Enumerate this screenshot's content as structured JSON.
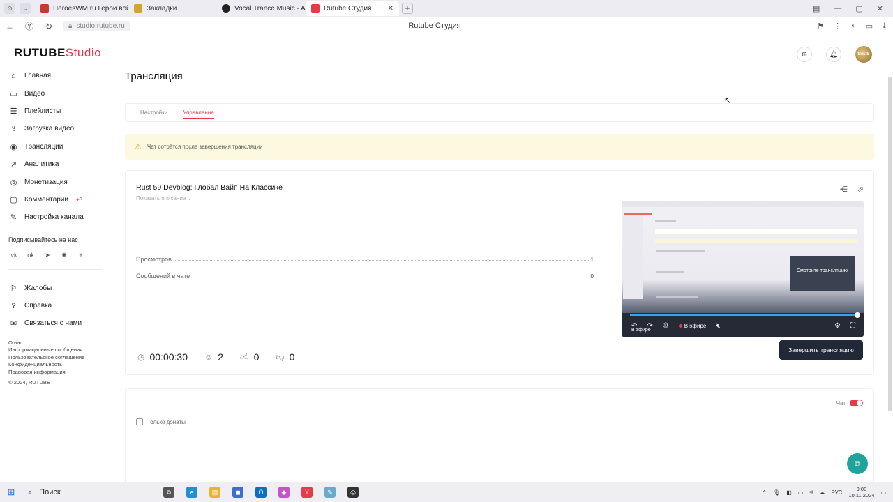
{
  "browser": {
    "tabs": [
      {
        "title": "HeroesWM.ru Герои войн",
        "color": "#c23b2f"
      },
      {
        "title": "Закладки",
        "color": "#d1a43a"
      },
      {
        "title": "Vocal Trance Music - Arise",
        "color": "#222"
      },
      {
        "title": "Rutube Студия",
        "color": "#e63a4a",
        "active": true
      }
    ],
    "new_tab": "+",
    "url": "studio.rutube.ru",
    "page_title": "Rutube Студия"
  },
  "app": {
    "logo_main": "RUTUBE",
    "logo_studio": "Studio",
    "avatar_text": "BestS"
  },
  "sidebar": {
    "items": [
      {
        "label": "Главная",
        "icon": "home-icon",
        "glyph": "⌂"
      },
      {
        "label": "Видео",
        "icon": "video-icon",
        "glyph": "▭"
      },
      {
        "label": "Плейлисты",
        "icon": "playlist-icon",
        "glyph": "☰"
      },
      {
        "label": "Загрузка видео",
        "icon": "upload-icon",
        "glyph": "⇪"
      },
      {
        "label": "Трансляции",
        "icon": "broadcast-icon",
        "glyph": "◉"
      },
      {
        "label": "Аналитика",
        "icon": "analytics-icon",
        "glyph": "↗"
      },
      {
        "label": "Монетизация",
        "icon": "money-icon",
        "glyph": "◎"
      },
      {
        "label": "Комментарии",
        "icon": "comments-icon",
        "glyph": "▢",
        "badge": "+3"
      },
      {
        "label": "Настройка канала",
        "icon": "settings-icon",
        "glyph": "✎"
      }
    ],
    "subscribe_heading": "Подписывайтесь на нас",
    "socials": [
      "vk",
      "ok",
      "tg",
      "zen",
      "+"
    ],
    "help_items": [
      {
        "label": "Жалобы",
        "icon": "complaints-icon",
        "glyph": "⚐"
      },
      {
        "label": "Справка",
        "icon": "help-icon",
        "glyph": "?"
      },
      {
        "label": "Связаться с нами",
        "icon": "contact-icon",
        "glyph": "✉"
      }
    ],
    "links": [
      "О нас",
      "Информационные сообщения",
      "Пользовательское соглашение",
      "Конфиденциальность",
      "Правовая информация",
      "© 2024, RUTUBE"
    ]
  },
  "page": {
    "heading": "Трансляция",
    "tabs": [
      "Настройки",
      "Управление"
    ],
    "warning": "Чат сотрётся после завершения трансляции",
    "stream_title": "Rust 59 Devblog: Глобал Вайп На Классике",
    "show_description": "Показать описание",
    "stats": [
      {
        "label": "Просмотров",
        "value": "1"
      },
      {
        "label": "Сообщений в чате",
        "value": "0"
      }
    ],
    "metrics": {
      "duration": "00:00:30",
      "viewers": "2",
      "likes": "0",
      "dislikes": "0"
    },
    "player": {
      "overlay": "Смотрите трансляцию",
      "live_label": "В эфире",
      "live_tag": "В эфире",
      "progress": 1.0
    },
    "end_button": "Завершить трансляцию",
    "chat": {
      "label": "Чат",
      "enabled": true,
      "donations_only": "Только донаты"
    }
  },
  "taskbar": {
    "search": "Поиск",
    "lang": "РУС",
    "time": "9:00",
    "date": "10.11.2024"
  }
}
